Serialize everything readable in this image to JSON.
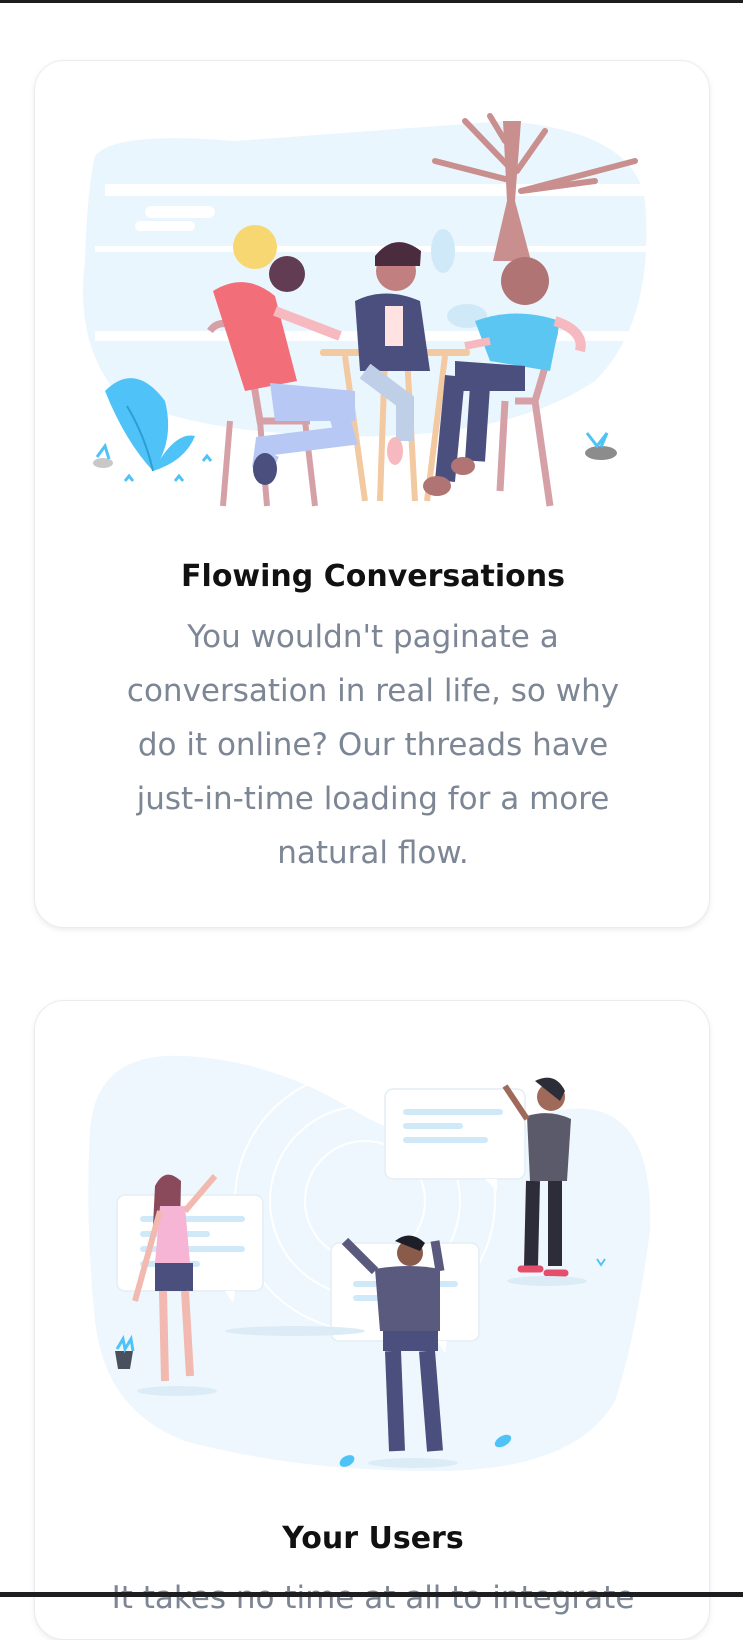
{
  "cards": [
    {
      "title": "Flowing Conversations",
      "text": "You wouldn't paginate a conversation in real life, so why do it online? Our threads have just-in-time loading for a more natural flow.",
      "illustration": "people-at-table-under-tree"
    },
    {
      "title": "Your Users",
      "text": "It takes no time at all to integrate",
      "illustration": "people-with-speech-bubbles"
    }
  ],
  "colors": {
    "title": "#111111",
    "body_text": "#7d8695",
    "pale_blue": "#eaf6fd",
    "accent_blue": "#4fc3f7"
  }
}
